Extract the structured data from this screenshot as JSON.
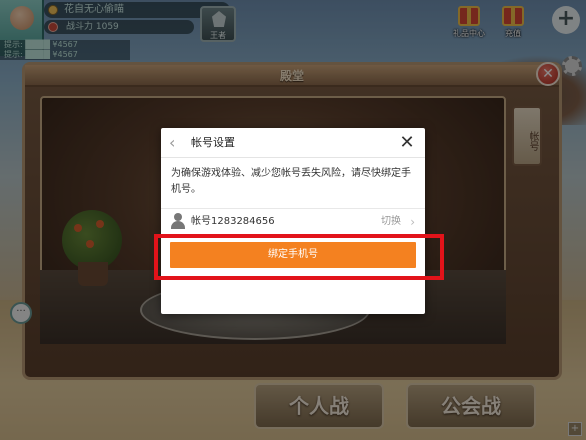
{
  "hud": {
    "player_name": "花自无心偷喵",
    "power_label": "战斗力 1059",
    "rank_label": "王者",
    "stats": [
      "提示: ████ ¥4567",
      "提示: ████ ¥4567",
      "提示 ████"
    ]
  },
  "top_right": {
    "gift_center_label": "礼品中心",
    "recharge_label": "充值",
    "plus": "+"
  },
  "panel": {
    "title": "殿堂",
    "side_tab": "帐号",
    "close": "✕"
  },
  "dialog": {
    "back": "‹",
    "title": "帐号设置",
    "close": "✕",
    "message": "为确保游戏体验、减少您帐号丢失风险，请尽快绑定手机号。",
    "account_label": "帐号1283284656",
    "switch_label": "切换",
    "switch_chevron": "›",
    "bind_button": "绑定手机号"
  },
  "bottom": {
    "personal_battle": "个人战",
    "guild_battle": "公会战",
    "corner": "+"
  },
  "chat": {
    "label": "···"
  },
  "colors": {
    "bind_button": "#f48120",
    "highlight": "#e2131a"
  }
}
